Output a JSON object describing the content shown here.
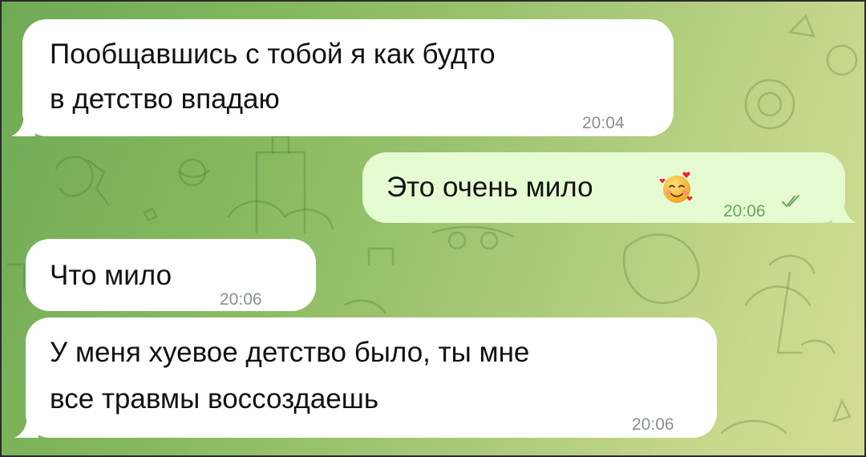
{
  "messages": [
    {
      "direction": "incoming",
      "lines": [
        "Пообщавшись с тобой я как будто",
        "в детство впадаю"
      ],
      "time": "20:04"
    },
    {
      "direction": "outgoing",
      "text": "Это очень мило",
      "emoji": "smiling-face-with-hearts",
      "time": "20:06",
      "status": "read"
    },
    {
      "direction": "incoming",
      "text": "Что мило",
      "time": "20:06"
    },
    {
      "direction": "incoming",
      "lines": [
        "У меня хуевое детство было, ты мне",
        "все травмы воссоздаешь"
      ],
      "time": "20:06"
    }
  ],
  "colors": {
    "incoming_bubble": "#ffffff",
    "outgoing_bubble": "#e6fbd2",
    "outgoing_time": "#6aa55a",
    "incoming_time": "#8a8f94",
    "wallpaper_start": "#6faa55",
    "wallpaper_end": "#d4dd94"
  },
  "icons": {
    "read_status": "double-check-icon",
    "wallpaper": "doodle-pattern"
  }
}
